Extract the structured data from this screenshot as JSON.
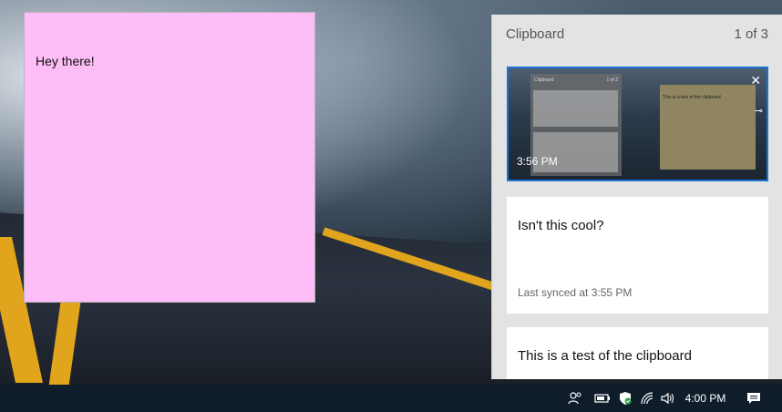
{
  "sticky_note": {
    "text": "Hey there!"
  },
  "clipboard": {
    "title": "Clipboard",
    "count": "1 of 3",
    "items": [
      {
        "type": "image",
        "timestamp": "3:56 PM",
        "thumbnail": {
          "panel_title": "Clipboard",
          "panel_count": "1 of 2",
          "note_text": "This is a test of the clipboard"
        }
      },
      {
        "type": "text",
        "text": "Isn't this cool?",
        "status": "Last synced at 3:55 PM"
      },
      {
        "type": "text",
        "text": "This is a test of the clipboard"
      }
    ]
  },
  "taskbar": {
    "time": "4:00 PM",
    "tray_icons": [
      "people-icon",
      "battery-icon",
      "security-icon",
      "wifi-icon",
      "volume-icon",
      "action-center-icon"
    ]
  },
  "colors": {
    "sticky_note": "#fdbdf6",
    "selection_border": "#1a73d4",
    "panel_bg": "#e3e3e3",
    "taskbar": "#0f1d2a"
  }
}
